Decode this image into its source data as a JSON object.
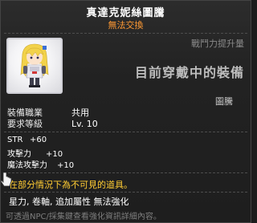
{
  "item": {
    "name": "真達克妮絲圖騰",
    "trade_status": "無法交換"
  },
  "compare": {
    "stat_change_label": "戰鬥力提升量",
    "equipped_label": "目前穿戴中的裝備"
  },
  "item_type": "圖騰",
  "requirements": [
    {
      "label": "裝備職業",
      "value": "共用"
    },
    {
      "label": "要求等級",
      "value": "Lv. 10"
    }
  ],
  "stats": [
    {
      "label": "STR",
      "value": "+60"
    },
    {
      "label": "攻擊力",
      "value": "+10"
    },
    {
      "label": "魔法攻擊力",
      "value": "+10"
    }
  ],
  "warning": "在部分情況下為不可見的道具。",
  "properties": "星力, 卷軸, 追加屬性 無法強化",
  "footer_hint": "可透過NPC/採集鍵查看強化資訊詳細內容。",
  "colors": {
    "title": "#ffffff",
    "trade_status": "#ff9933",
    "warning": "#ffcc33",
    "hint": "#7e7e7e"
  },
  "icons": {
    "portrait": "darkness-totem-character-portrait",
    "cursor": "glove-cursor-icon"
  }
}
